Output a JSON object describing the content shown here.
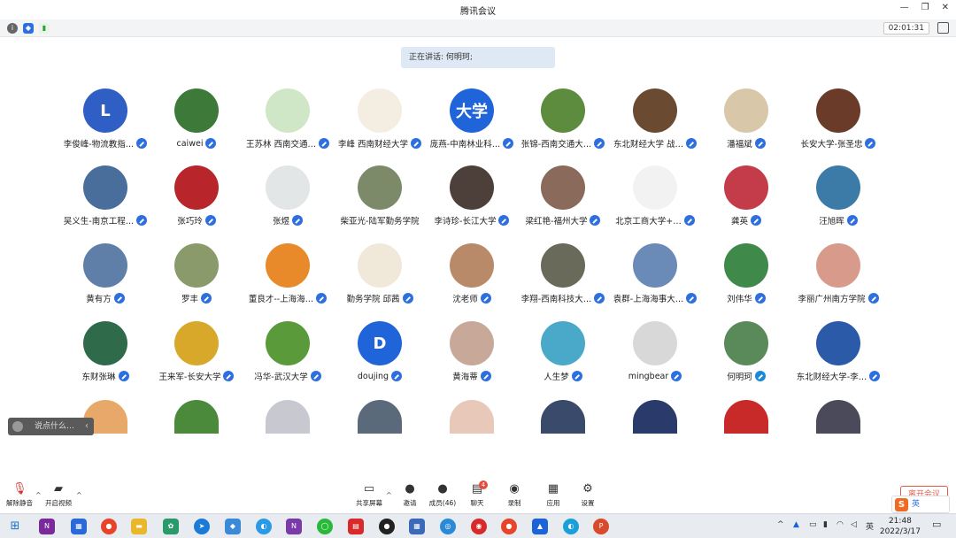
{
  "window": {
    "title": "腾讯会议"
  },
  "infobar": {
    "timer": "02:01:31"
  },
  "speaking": {
    "label": "正在讲话:",
    "name": "何明珂;"
  },
  "participants": [
    {
      "name": "李俊峰-物流教指…",
      "avatar_text": "L",
      "color": "#2f5fc4",
      "mic": "on"
    },
    {
      "name": "caiwei",
      "avatar_text": "",
      "color": "#3d7a3a",
      "mic": "on"
    },
    {
      "name": "王苏林 西南交通…",
      "avatar_text": "",
      "color": "#cfe6c7",
      "mic": "on"
    },
    {
      "name": "李峰 西南财经大学",
      "avatar_text": "",
      "color": "#f4ede2",
      "mic": "on"
    },
    {
      "name": "庞燕-中南林业科…",
      "avatar_text": "大学",
      "color": "#1f64d8",
      "mic": "on"
    },
    {
      "name": "张锦-西南交通大…",
      "avatar_text": "",
      "color": "#5e8c3e",
      "mic": "on"
    },
    {
      "name": "东北财经大学 战…",
      "avatar_text": "",
      "color": "#6b4a32",
      "mic": "on"
    },
    {
      "name": "潘福斌",
      "avatar_text": "",
      "color": "#d9c7a9",
      "mic": "on"
    },
    {
      "name": "长安大学-张圣忠",
      "avatar_text": "",
      "color": "#6b3b2a",
      "mic": "on"
    },
    {
      "name": "吴义生-南京工程…",
      "avatar_text": "",
      "color": "#4a6e9c",
      "mic": "on"
    },
    {
      "name": "张巧玲",
      "avatar_text": "",
      "color": "#b8262b",
      "mic": "on"
    },
    {
      "name": "张煜",
      "avatar_text": "",
      "color": "#e3e6e7",
      "mic": "on"
    },
    {
      "name": "柴亚光-陆军勤务学院",
      "avatar_text": "",
      "color": "#7d8a6a",
      "mic": "off"
    },
    {
      "name": "李诗珍-长江大学",
      "avatar_text": "",
      "color": "#4d3f3a",
      "mic": "on"
    },
    {
      "name": "梁红艳-福州大学",
      "avatar_text": "",
      "color": "#8a6a5a",
      "mic": "on"
    },
    {
      "name": "北京工商大学+…",
      "avatar_text": "",
      "color": "#f2f2f2",
      "mic": "on"
    },
    {
      "name": "龚英",
      "avatar_text": "",
      "color": "#c43c4a",
      "mic": "on"
    },
    {
      "name": "汪旭晖",
      "avatar_text": "",
      "color": "#3c7aa8",
      "mic": "on"
    },
    {
      "name": "黄有方",
      "avatar_text": "",
      "color": "#5f7fa8",
      "mic": "on"
    },
    {
      "name": "罗丰",
      "avatar_text": "",
      "color": "#8a9a6a",
      "mic": "on"
    },
    {
      "name": "董良才--上海海…",
      "avatar_text": "",
      "color": "#e8892a",
      "mic": "on"
    },
    {
      "name": "勤务学院 邱茜",
      "avatar_text": "",
      "color": "#f0e8d8",
      "mic": "on"
    },
    {
      "name": "沈老师",
      "avatar_text": "",
      "color": "#b88a6a",
      "mic": "on"
    },
    {
      "name": "李翔-西南科技大…",
      "avatar_text": "",
      "color": "#6a6a5a",
      "mic": "on"
    },
    {
      "name": "袁群-上海海事大…",
      "avatar_text": "",
      "color": "#6a8ab8",
      "mic": "on"
    },
    {
      "name": "刘伟华",
      "avatar_text": "",
      "color": "#3f8a4a",
      "mic": "on"
    },
    {
      "name": "李丽广州南方学院",
      "avatar_text": "",
      "color": "#d89a8a",
      "mic": "on"
    },
    {
      "name": "东财张琳",
      "avatar_text": "",
      "color": "#2f6a4a",
      "mic": "on"
    },
    {
      "name": "王来军-长安大学",
      "avatar_text": "",
      "color": "#d8a82a",
      "mic": "on"
    },
    {
      "name": "冯华-武汉大学",
      "avatar_text": "",
      "color": "#5a9a3a",
      "mic": "on"
    },
    {
      "name": "doujing",
      "avatar_text": "D",
      "color": "#1f64d8",
      "mic": "on"
    },
    {
      "name": "黄海蒂",
      "avatar_text": "",
      "color": "#c8a898",
      "mic": "on"
    },
    {
      "name": "人生梦",
      "avatar_text": "",
      "color": "#4aa8c8",
      "mic": "on"
    },
    {
      "name": "mingbear",
      "avatar_text": "",
      "color": "#d8d8d8",
      "mic": "on"
    },
    {
      "name": "何明珂",
      "avatar_text": "",
      "color": "#5a8a5a",
      "mic": "speaking"
    },
    {
      "name": "东北财经大学-李…",
      "avatar_text": "",
      "color": "#2a5aa8",
      "mic": "on"
    },
    {
      "name": "",
      "avatar_text": "",
      "color": "#e8a86a",
      "mic": "none"
    },
    {
      "name": "",
      "avatar_text": "",
      "color": "#4a8a3a",
      "mic": "none"
    },
    {
      "name": "",
      "avatar_text": "",
      "color": "#c8c8d0",
      "mic": "none"
    },
    {
      "name": "",
      "avatar_text": "",
      "color": "#5a6a7a",
      "mic": "none"
    },
    {
      "name": "",
      "avatar_text": "",
      "color": "#e8c8b8",
      "mic": "none"
    },
    {
      "name": "",
      "avatar_text": "",
      "color": "#3a4a6a",
      "mic": "none"
    },
    {
      "name": "",
      "avatar_text": "",
      "color": "#2a3a6a",
      "mic": "none"
    },
    {
      "name": "",
      "avatar_text": "",
      "color": "#c82a2a",
      "mic": "none"
    },
    {
      "name": "",
      "avatar_text": "",
      "color": "#4a4a5a",
      "mic": "none"
    }
  ],
  "chat": {
    "placeholder": "说点什么…"
  },
  "toolbar": {
    "unmute": "解除静音",
    "start_video": "开启视频",
    "share": "共享屏幕",
    "invite": "邀请",
    "members": "成员(46)",
    "chat": "聊天",
    "chat_badge": "4",
    "record": "录制",
    "apps": "应用",
    "settings": "设置",
    "end": "离开会议"
  },
  "ime": {
    "label": "英"
  },
  "taskbar": {
    "time": "21:48",
    "date": "2022/3/17",
    "lang": "英"
  }
}
